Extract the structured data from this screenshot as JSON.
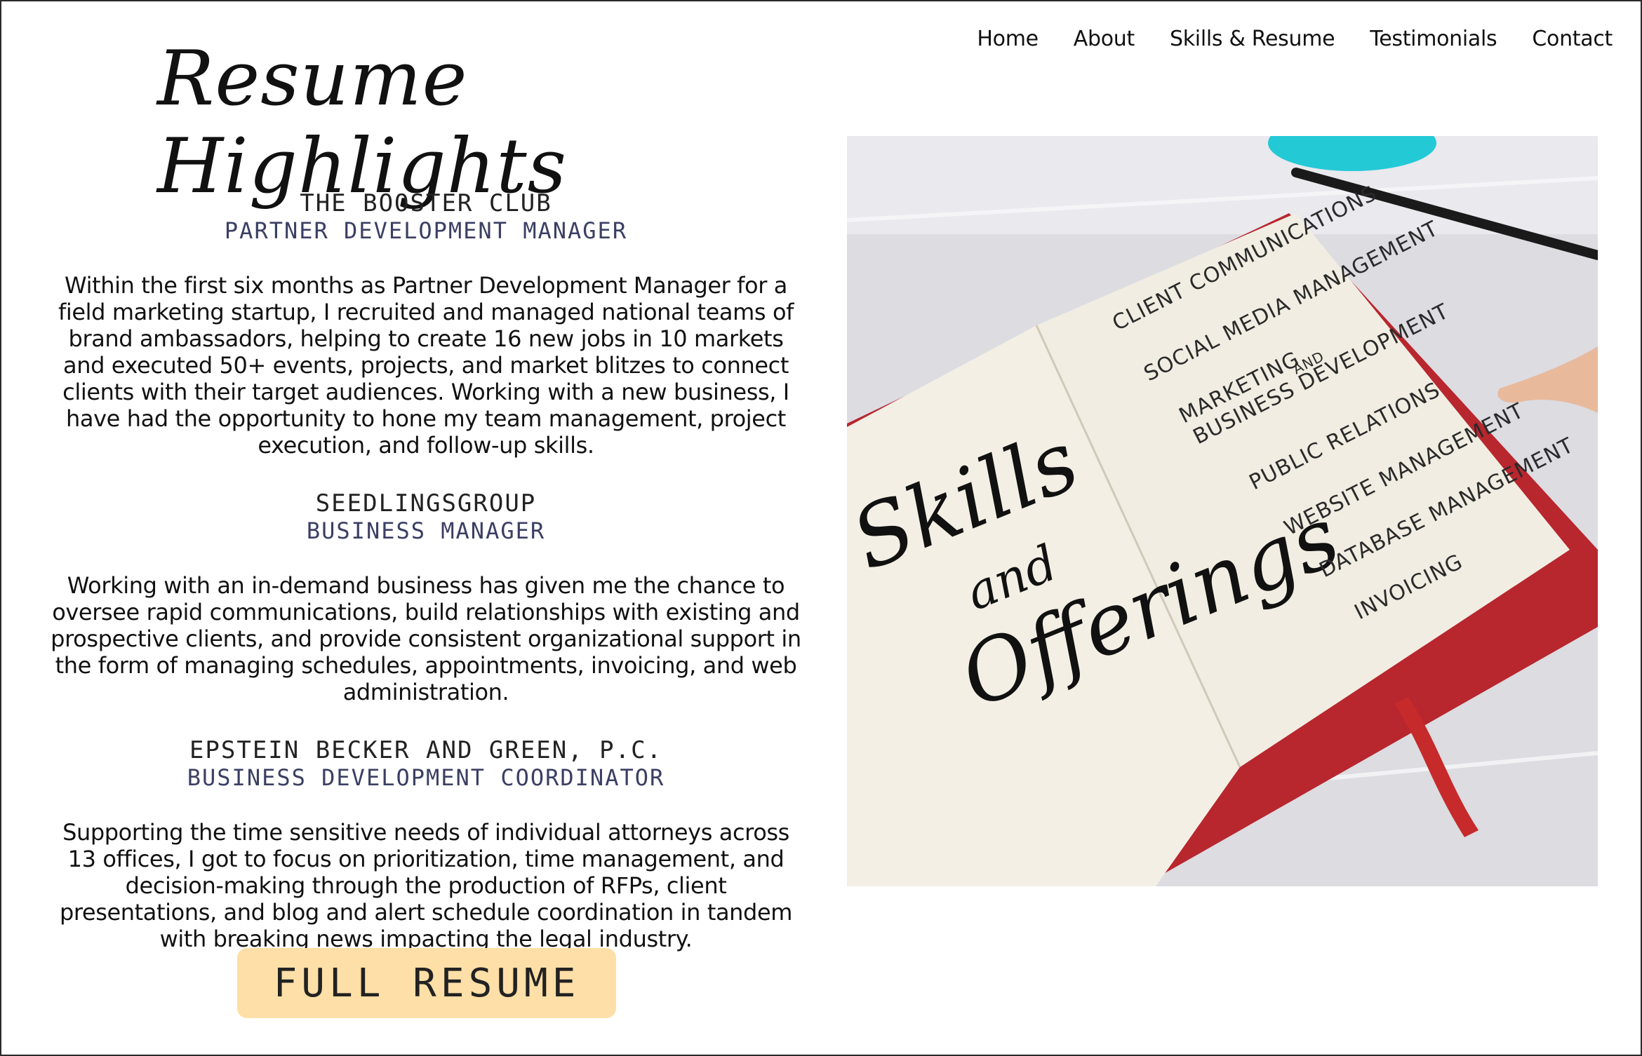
{
  "nav": {
    "items": [
      "Home",
      "About",
      "Skills & Resume",
      "Testimonials",
      "Contact"
    ]
  },
  "page": {
    "title": "Resume Highlights"
  },
  "jobs": [
    {
      "company": "THE BOOSTER CLUB",
      "role": "PARTNER DEVELOPMENT MANAGER",
      "description": "Within the first six months as Partner Development Manager for a field marketing startup, I recruited and managed national teams of brand ambassadors, helping to create 16 new jobs in 10 markets and executed 50+ events, projects, and market blitzes to connect clients with their target audiences. Working with a new business, I have had the opportunity to hone my team management, project execution, and follow-up skills."
    },
    {
      "company": "SEEDLINGSGROUP",
      "role": "BUSINESS MANAGER",
      "description": "Working with an in-demand business has given me the chance to oversee rapid communications, build relationships with existing and prospective clients, and provide consistent organizational support in the form of managing schedules, appointments, invoicing, and web administration."
    },
    {
      "company": "EPSTEIN BECKER AND GREEN, P.C.",
      "role": "BUSINESS DEVELOPMENT COORDINATOR",
      "description": "Supporting the time sensitive needs of individual attorneys across 13 offices, I got to focus on prioritization, time management, and decision-making through the production of RFPs, client presentations, and blog and alert schedule coordination in tandem with breaking news impacting the legal industry."
    }
  ],
  "cta": {
    "label": "FULL RESUME"
  },
  "hero_image": {
    "left_page": {
      "word1": "Skills",
      "word2": "and",
      "word3": "Offerings"
    },
    "right_page_items": [
      "CLIENT COMMUNICATIONS",
      "SOCIAL MEDIA MANAGEMENT",
      "MARKETING",
      "AND",
      "BUSINESS DEVELOPMENT",
      "PUBLIC RELATIONS",
      "WEBSITE MANAGEMENT",
      "DATABASE MANAGEMENT",
      "INVOICING"
    ]
  },
  "colors": {
    "cta_bg": "#fddfa7",
    "role_text": "#3b3f63",
    "book_cover": "#b8262e",
    "ribbon": "#c62a2a"
  }
}
